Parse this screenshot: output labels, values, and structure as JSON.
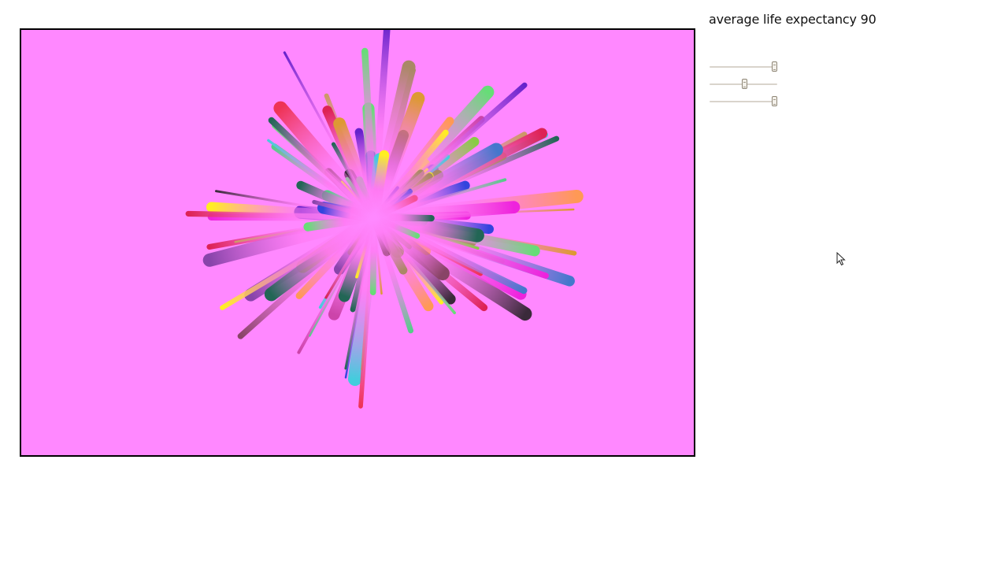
{
  "canvas": {
    "background": "#ff88ff",
    "border_color": "#000000"
  },
  "status": {
    "label": "average life expectancy 90"
  },
  "sliders": [
    {
      "name": "slider-1",
      "value": 0.97
    },
    {
      "name": "slider-2",
      "value": 0.52
    },
    {
      "name": "slider-3",
      "value": 0.97
    }
  ],
  "burst_palette": [
    "#3a2a3a",
    "#ff9955",
    "#44ccdd",
    "#cc9966",
    "#ffee22",
    "#dd2255",
    "#6622cc",
    "#ee3355",
    "#66dd77",
    "#3344dd",
    "#cc44aa",
    "#55cc88",
    "#226655",
    "#aa8866",
    "#ee22dd",
    "#dd9933",
    "#4477cc",
    "#884466",
    "#88cc44",
    "#8844aa"
  ],
  "icons": {
    "cursor": "mouse-pointer-icon"
  }
}
